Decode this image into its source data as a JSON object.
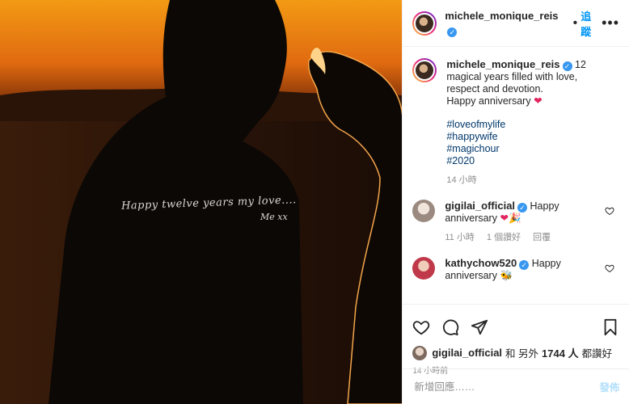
{
  "header": {
    "username": "michele_monique_reis",
    "separator": "•",
    "follow_label": "追蹤",
    "more": "•••"
  },
  "photo": {
    "overlay_text": "Happy twelve years my love....",
    "overlay_sign": "Me xx"
  },
  "caption": {
    "username": "michele_monique_reis",
    "text_line1": "12 magical years filled with love, respect and devotion.",
    "text_line2": "Happy anniversary",
    "hashtags": [
      "#loveofmylife",
      "#happywife",
      "#magichour",
      "#2020"
    ],
    "time": "14 小時"
  },
  "comments": [
    {
      "username": "gigilai_official",
      "text": "Happy anniversary",
      "time": "11 小時",
      "likes": "1 個讚好",
      "reply": "回覆"
    },
    {
      "username": "kathychow520",
      "text": "Happy anniversary",
      "time": "",
      "likes": "",
      "reply": ""
    }
  ],
  "likes_line": {
    "user": "gigilai_official",
    "middle": "和 另外",
    "count": "1744 人",
    "tail": "都讚好"
  },
  "post_time": "14 小時前",
  "add_comment": {
    "placeholder": "新增回應……",
    "post_label": "發佈"
  },
  "colors": {
    "accent": "#0095f6",
    "heart": "#e0245e",
    "verified": "#3897f0"
  }
}
